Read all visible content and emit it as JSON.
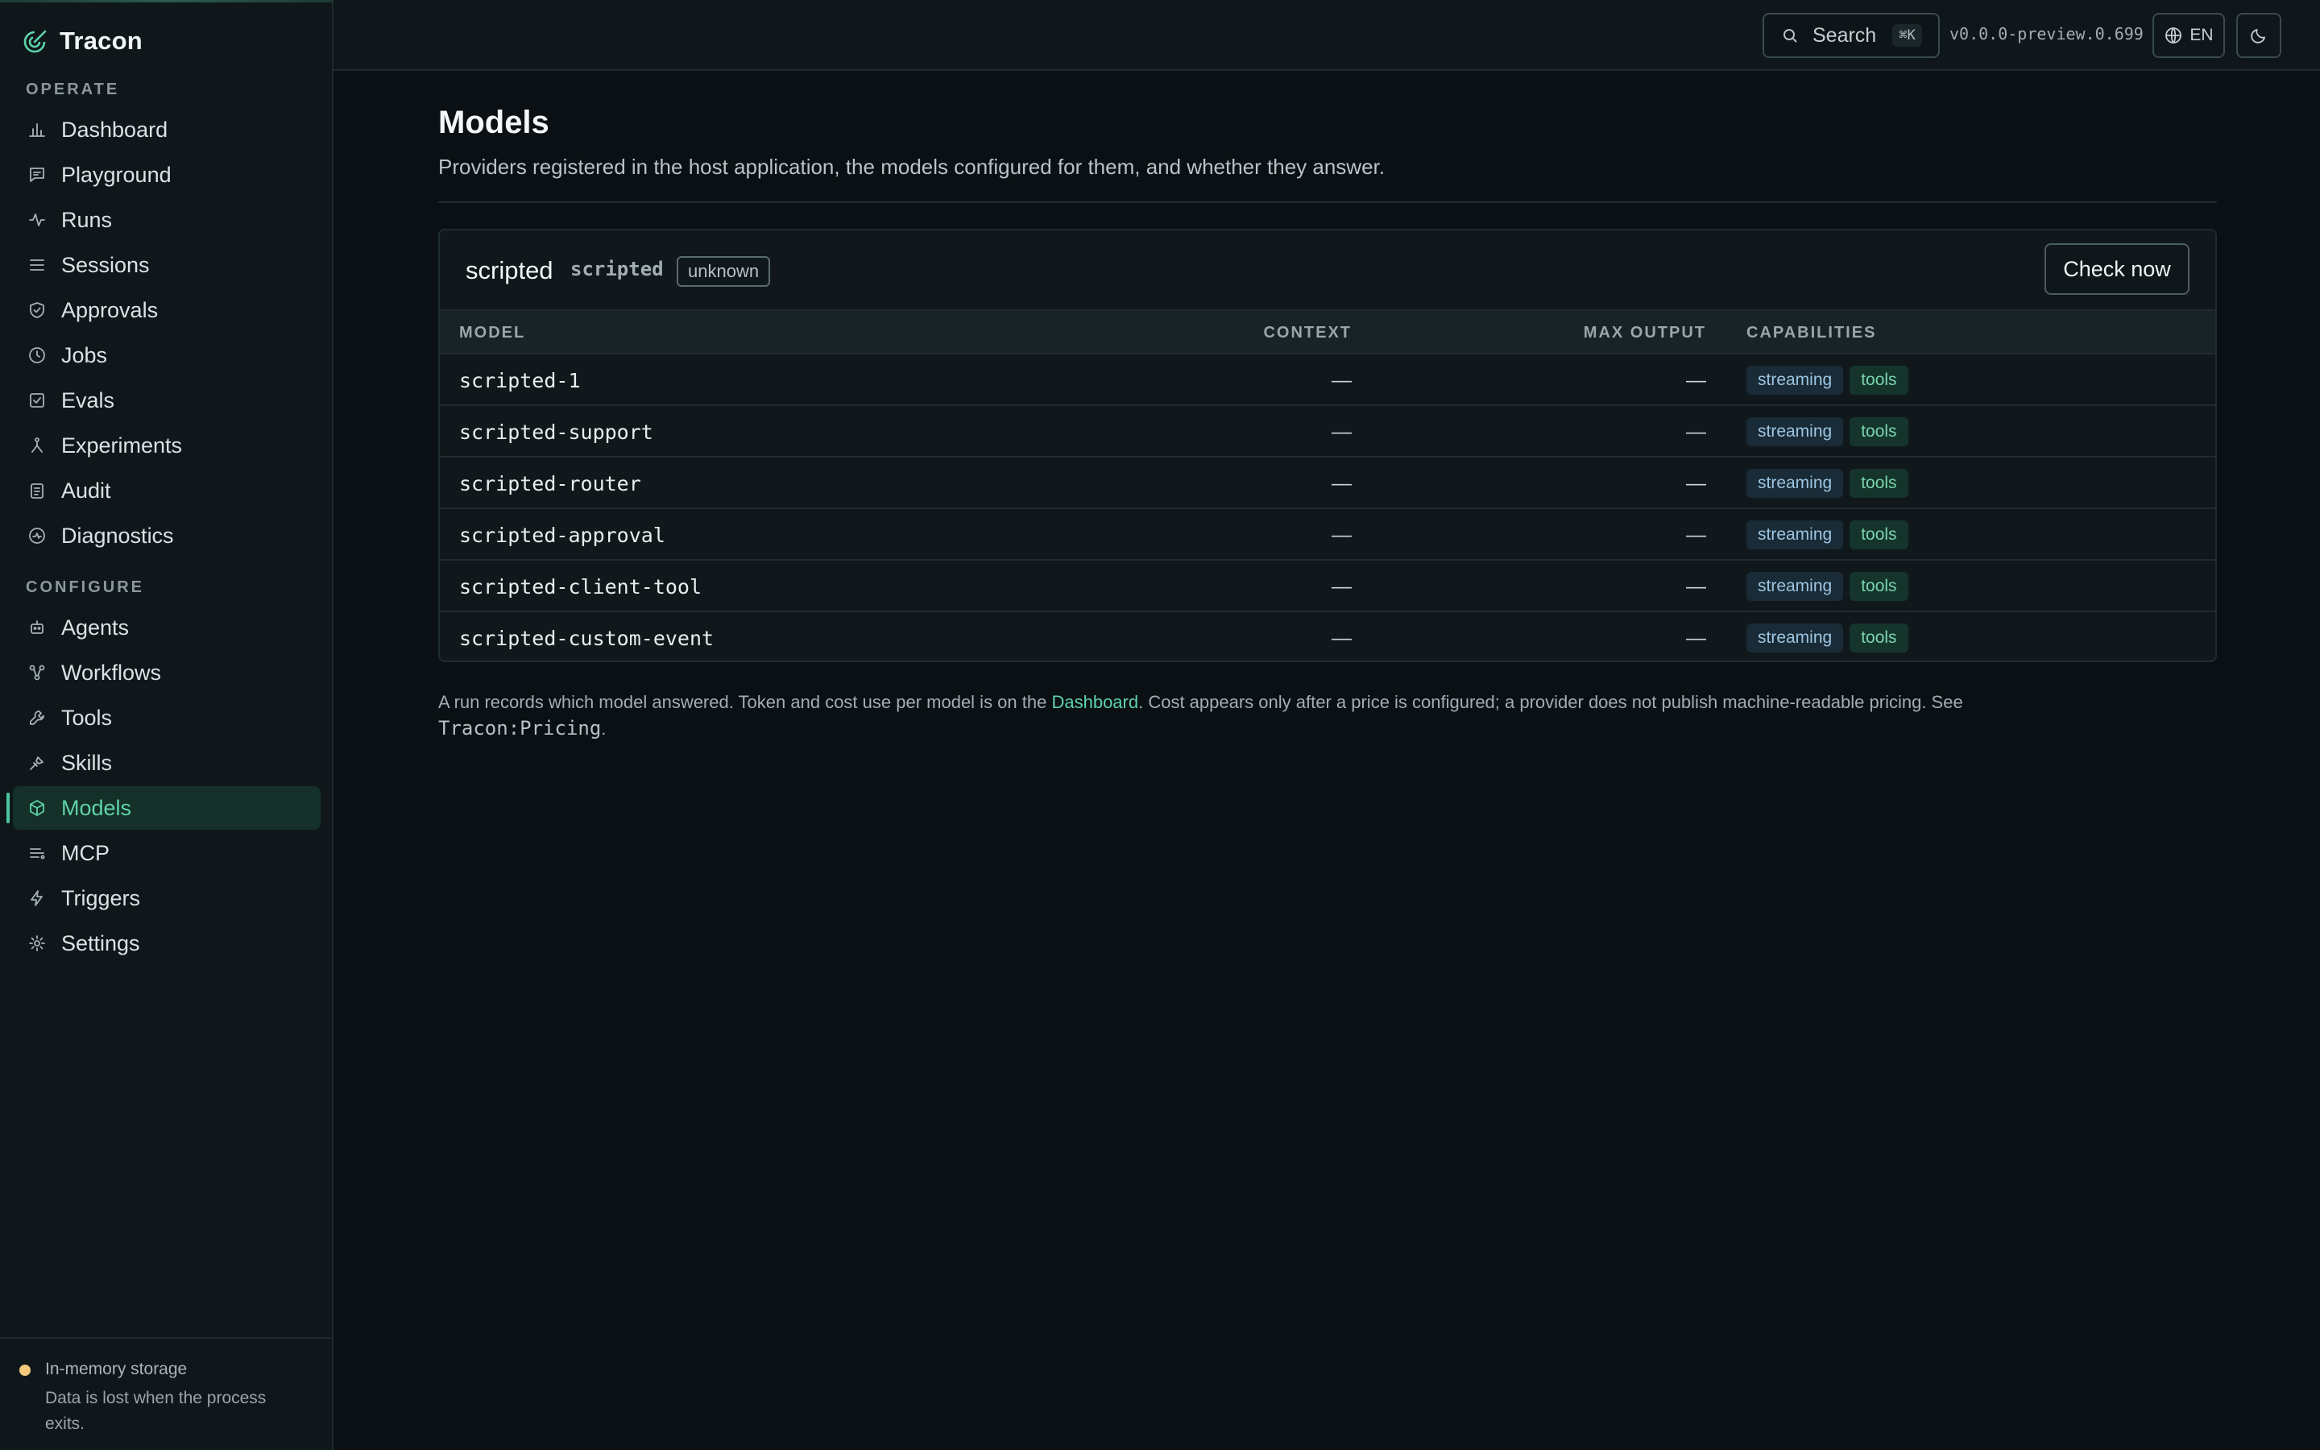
{
  "app": {
    "name": "Tracon"
  },
  "sidebar": {
    "sections": [
      {
        "label": "OPERATE",
        "items": [
          {
            "label": "Dashboard",
            "icon": "bar-chart-icon"
          },
          {
            "label": "Playground",
            "icon": "message-icon"
          },
          {
            "label": "Runs",
            "icon": "activity-icon"
          },
          {
            "label": "Sessions",
            "icon": "list-icon"
          },
          {
            "label": "Approvals",
            "icon": "shield-check-icon"
          },
          {
            "label": "Jobs",
            "icon": "clock-icon"
          },
          {
            "label": "Evals",
            "icon": "checkbox-icon"
          },
          {
            "label": "Experiments",
            "icon": "branch-icon"
          },
          {
            "label": "Audit",
            "icon": "clipboard-icon"
          },
          {
            "label": "Diagnostics",
            "icon": "diagnostics-icon"
          }
        ]
      },
      {
        "label": "CONFIGURE",
        "items": [
          {
            "label": "Agents",
            "icon": "bot-icon"
          },
          {
            "label": "Workflows",
            "icon": "workflow-icon"
          },
          {
            "label": "Tools",
            "icon": "wrench-icon"
          },
          {
            "label": "Skills",
            "icon": "skill-icon"
          },
          {
            "label": "Models",
            "icon": "cube-icon",
            "active": true
          },
          {
            "label": "MCP",
            "icon": "mcp-icon"
          },
          {
            "label": "Triggers",
            "icon": "bolt-icon"
          },
          {
            "label": "Settings",
            "icon": "sun-gear-icon"
          }
        ]
      }
    ],
    "footer": {
      "title": "In-memory storage",
      "text": "Data is lost when the process exits.",
      "status_color": "#f3c87a"
    }
  },
  "topbar": {
    "search_label": "Search",
    "search_shortcut": "⌘K",
    "version": "v0.0.0-preview.0.699",
    "language": "EN"
  },
  "page": {
    "title": "Models",
    "subtitle": "Providers registered in the host application, the models configured for them, and whether they answer."
  },
  "provider": {
    "name": "scripted",
    "id": "scripted",
    "status": "unknown",
    "check_label": "Check now",
    "columns": [
      "MODEL",
      "CONTEXT",
      "MAX OUTPUT",
      "CAPABILITIES"
    ],
    "models": [
      {
        "name": "scripted-1",
        "context": "—",
        "max_output": "—",
        "capabilities": [
          "streaming",
          "tools"
        ]
      },
      {
        "name": "scripted-support",
        "context": "—",
        "max_output": "—",
        "capabilities": [
          "streaming",
          "tools"
        ]
      },
      {
        "name": "scripted-router",
        "context": "—",
        "max_output": "—",
        "capabilities": [
          "streaming",
          "tools"
        ]
      },
      {
        "name": "scripted-approval",
        "context": "—",
        "max_output": "—",
        "capabilities": [
          "streaming",
          "tools"
        ]
      },
      {
        "name": "scripted-client-tool",
        "context": "—",
        "max_output": "—",
        "capabilities": [
          "streaming",
          "tools"
        ]
      },
      {
        "name": "scripted-custom-event",
        "context": "—",
        "max_output": "—",
        "capabilities": [
          "streaming",
          "tools"
        ]
      }
    ]
  },
  "note": {
    "before": "A run records which model answered. Token and cost use per model is on the ",
    "link": "Dashboard",
    "after": ". Cost appears only after a price is configured; a provider does not publish machine-readable pricing. See ",
    "code": "Tracon:Pricing",
    "end": "."
  },
  "colors": {
    "accent": "#5fd3a9",
    "background": "#0a1013",
    "sidebar": "#0f171b"
  }
}
